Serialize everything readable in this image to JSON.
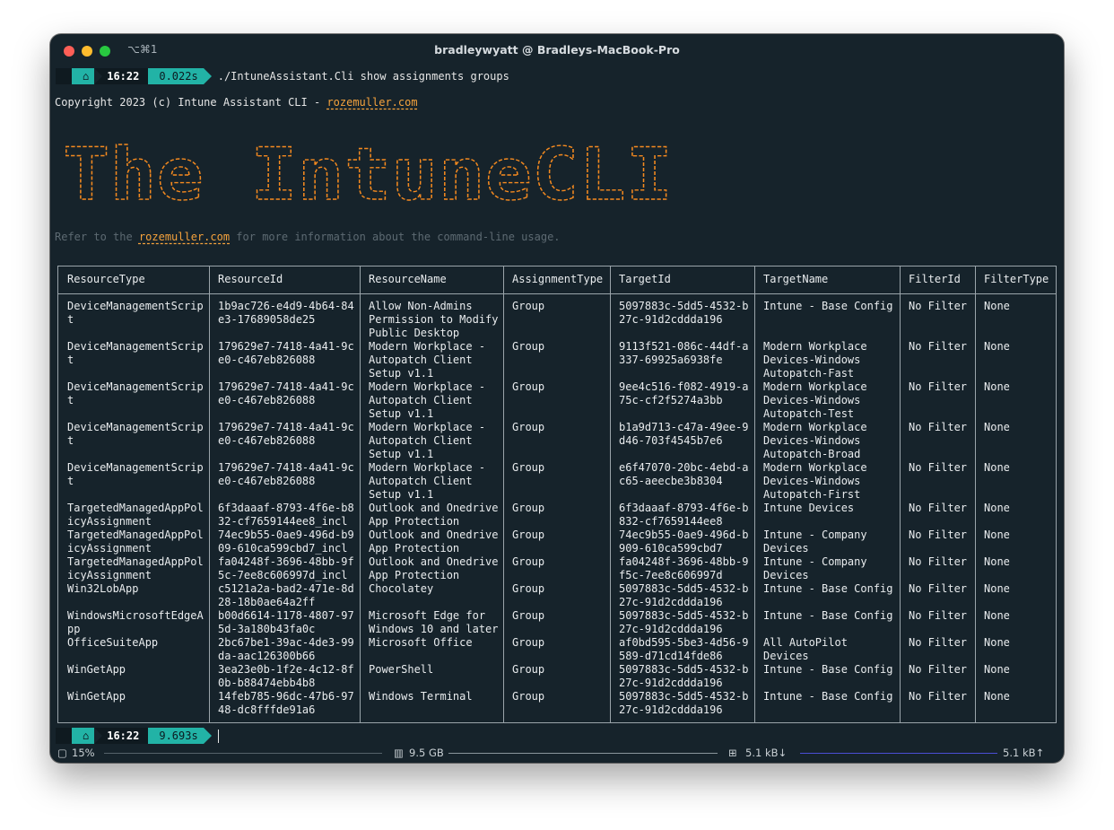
{
  "window": {
    "title": "bradleywyatt @ Bradleys-MacBook-Pro",
    "shortcut": "⌥⌘1"
  },
  "prompt1": {
    "apple": "",
    "home_icon": "⌂",
    "time": "16:22",
    "duration": "0.022s",
    "command": "./IntuneAssistant.Cli show assignments groups"
  },
  "copyright": {
    "prefix": "Copyright 2023 (c) Intune Assistant CLI - ",
    "link": "rozemuller.com"
  },
  "banner": {
    "text": "The IntuneCLI",
    "color": "#f58a1f"
  },
  "refer": {
    "prefix": "Refer to the ",
    "link": "rozemuller.com",
    "suffix": " for more information about the command-line usage."
  },
  "table": {
    "headers": [
      "ResourceType",
      "ResourceId",
      "ResourceName",
      "AssignmentType",
      "TargetId",
      "TargetName",
      "FilterId",
      "FilterType"
    ],
    "rows": [
      [
        "DeviceManagementScrip\nt",
        "1b9ac726-e4d9-4b64-84\ne3-17689058de25",
        "Allow Non-Admins\nPermission to Modify\nPublic Desktop",
        "Group",
        "5097883c-5dd5-4532-b\n27c-91d2cddda196",
        "Intune - Base Config",
        "No Filter",
        "None"
      ],
      [
        "DeviceManagementScrip\nt",
        "179629e7-7418-4a41-9c\ne0-c467eb826088",
        "Modern Workplace -\nAutopatch Client\nSetup v1.1",
        "Group",
        "9113f521-086c-44df-a\n337-69925a6938fe",
        "Modern Workplace\nDevices-Windows\nAutopatch-Fast",
        "No Filter",
        "None"
      ],
      [
        "DeviceManagementScrip\nt",
        "179629e7-7418-4a41-9c\ne0-c467eb826088",
        "Modern Workplace -\nAutopatch Client\nSetup v1.1",
        "Group",
        "9ee4c516-f082-4919-a\n75c-cf2f5274a3bb",
        "Modern Workplace\nDevices-Windows\nAutopatch-Test",
        "No Filter",
        "None"
      ],
      [
        "DeviceManagementScrip\nt",
        "179629e7-7418-4a41-9c\ne0-c467eb826088",
        "Modern Workplace -\nAutopatch Client\nSetup v1.1",
        "Group",
        "b1a9d713-c47a-49ee-9\nd46-703f4545b7e6",
        "Modern Workplace\nDevices-Windows\nAutopatch-Broad",
        "No Filter",
        "None"
      ],
      [
        "DeviceManagementScrip\nt",
        "179629e7-7418-4a41-9c\ne0-c467eb826088",
        "Modern Workplace -\nAutopatch Client\nSetup v1.1",
        "Group",
        "e6f47070-20bc-4ebd-a\nc65-aeecbe3b8304",
        "Modern Workplace\nDevices-Windows\nAutopatch-First",
        "No Filter",
        "None"
      ],
      [
        "TargetedManagedAppPol\nicyAssignment",
        "6f3daaaf-8793-4f6e-b8\n32-cf7659144ee8_incl",
        "Outlook and Onedrive\nApp Protection",
        "Group",
        "6f3daaaf-8793-4f6e-b\n832-cf7659144ee8",
        "Intune Devices",
        "No Filter",
        "None"
      ],
      [
        "TargetedManagedAppPol\nicyAssignment",
        "74ec9b55-0ae9-496d-b9\n09-610ca599cbd7_incl",
        "Outlook and Onedrive\nApp Protection",
        "Group",
        "74ec9b55-0ae9-496d-b\n909-610ca599cbd7",
        "Intune - Company\nDevices",
        "No Filter",
        "None"
      ],
      [
        "TargetedManagedAppPol\nicyAssignment",
        "fa04248f-3696-48bb-9f\n5c-7ee8c606997d_incl",
        "Outlook and Onedrive\nApp Protection",
        "Group",
        "fa04248f-3696-48bb-9\nf5c-7ee8c606997d",
        "Intune - Company\nDevices",
        "No Filter",
        "None"
      ],
      [
        "Win32LobApp",
        "c5121a2a-bad2-471e-8d\n28-18b0ae64a2ff",
        "Chocolatey",
        "Group",
        "5097883c-5dd5-4532-b\n27c-91d2cddda196",
        "Intune - Base Config",
        "No Filter",
        "None"
      ],
      [
        "WindowsMicrosoftEdgeA\npp",
        "b00d6614-1178-4807-97\n5d-3a180b43fa0c",
        "Microsoft Edge for\nWindows 10 and later",
        "Group",
        "5097883c-5dd5-4532-b\n27c-91d2cddda196",
        "Intune - Base Config",
        "No Filter",
        "None"
      ],
      [
        "OfficeSuiteApp",
        "2bc67be1-39ac-4de3-99\nda-aac126300b66",
        "Microsoft Office",
        "Group",
        "af0bd595-5be3-4d56-9\n589-d71cd14fde86",
        "All AutoPilot\nDevices",
        "No Filter",
        "None"
      ],
      [
        "WinGetApp",
        "3ea23e0b-1f2e-4c12-8f\n0b-b88474ebb4b8",
        "PowerShell",
        "Group",
        "5097883c-5dd5-4532-b\n27c-91d2cddda196",
        "Intune - Base Config",
        "No Filter",
        "None"
      ],
      [
        "WinGetApp",
        "14feb785-96dc-47b6-97\n48-dc8fffde91a6",
        "Windows Terminal",
        "Group",
        "5097883c-5dd5-4532-b\n27c-91d2cddda196",
        "Intune - Base Config",
        "No Filter",
        "None"
      ]
    ]
  },
  "prompt2": {
    "apple": "",
    "home_icon": "⌂",
    "time": "16:22",
    "duration": "9.693s"
  },
  "statusbar": {
    "cpu": "15%",
    "memory": "9.5 GB",
    "net_down": "5.1 kB↓",
    "net_up": "5.1 kB↑",
    "cpu_icon": "cpu-icon",
    "memory_icon": "memory-icon",
    "network_icon": "network-icon"
  }
}
